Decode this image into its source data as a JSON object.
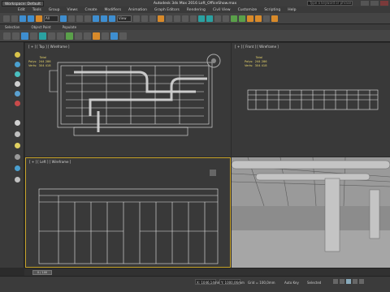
{
  "title_bar": {
    "workspace": "Workspace: Default",
    "title": "Autodesk 3ds Max 2016    Loft_OfficeShow.max",
    "search_placeholder": "Type a keyword or phrase"
  },
  "menu": [
    "Edit",
    "Tools",
    "Group",
    "Views",
    "Create",
    "Modifiers",
    "Animation",
    "Graph Editors",
    "Rendering",
    "Civil View",
    "Customize",
    "Scripting",
    "Help"
  ],
  "toolbar": {
    "selection_filter": "All",
    "view_dropdown": "View"
  },
  "ribbon_tabs": [
    "Selection",
    "Object Paint",
    "Populate"
  ],
  "viewports": {
    "top": {
      "label": "[ + ] [ Top ] [ Wireframe ]",
      "stats": "            Total\nPolys:  244 286\nVerts:  304 418"
    },
    "front": {
      "label": "[ + ] [ Front ] [ Wireframe ]",
      "stats": "            Total\nPolys:  244 286\nVerts:  304 418"
    },
    "left": {
      "label": "[ + ] [ Left ] [ Wireframe ]"
    },
    "perspective": {
      "label": ""
    }
  },
  "timeline": {
    "frame": "0 / 100"
  },
  "status": {
    "x": "X: 1046,14mm",
    "y": "Y: 1000,06mm",
    "grid": "Grid = 100,0mm",
    "auto": "Auto Key",
    "selected": "Selected"
  },
  "colors": {
    "accent": "#3e8ed0",
    "stats": "#e6d36a",
    "active_border": "#c8a42a"
  }
}
